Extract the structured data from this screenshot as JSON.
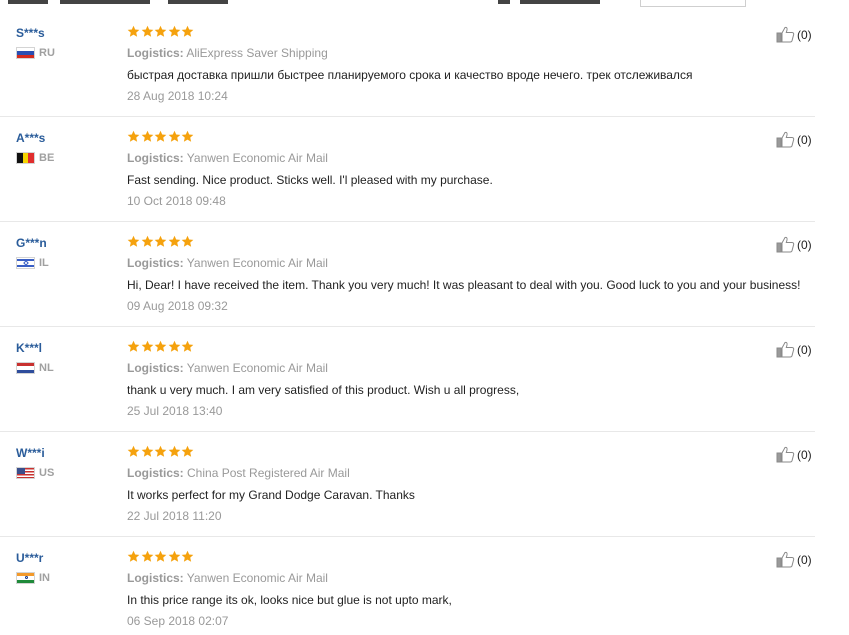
{
  "reviews": [
    {
      "user": "S***s",
      "country": "RU",
      "logistics_label": "Logistics:",
      "logistics": "AliExpress Saver Shipping",
      "comment": "быстрая доставка пришли быстрее планируемого срока и качество вроде нечего. трек отслеживался",
      "date": "28 Aug 2018 10:24",
      "helpful": "(0)",
      "rating": 5
    },
    {
      "user": "A***s",
      "country": "BE",
      "logistics_label": "Logistics:",
      "logistics": "Yanwen Economic Air Mail",
      "comment": "Fast sending. Nice product. Sticks well. I'l pleased with my purchase.",
      "date": "10 Oct 2018 09:48",
      "helpful": "(0)",
      "rating": 5
    },
    {
      "user": "G***n",
      "country": "IL",
      "logistics_label": "Logistics:",
      "logistics": "Yanwen Economic Air Mail",
      "comment": "Hi, Dear! I have received the item. Thank you very much! It was pleasant to deal with you. Good luck to you and your business!",
      "date": "09 Aug 2018 09:32",
      "helpful": "(0)",
      "rating": 5
    },
    {
      "user": "K***l",
      "country": "NL",
      "logistics_label": "Logistics:",
      "logistics": "Yanwen Economic Air Mail",
      "comment": "thank u very much. I am very satisfied of this product. Wish u all progress,",
      "date": "25 Jul 2018 13:40",
      "helpful": "(0)",
      "rating": 5
    },
    {
      "user": "W***i",
      "country": "US",
      "logistics_label": "Logistics:",
      "logistics": "China Post Registered Air Mail",
      "comment": "It works perfect for my Grand Dodge Caravan. Thanks",
      "date": "22 Jul 2018 11:20",
      "helpful": "(0)",
      "rating": 5
    },
    {
      "user": "U***r",
      "country": "IN",
      "logistics_label": "Logistics:",
      "logistics": "Yanwen Economic Air Mail",
      "comment": "In this price range its ok, looks nice but glue is not upto mark,",
      "date": "06 Sep 2018 02:07",
      "helpful": "(0)",
      "rating": 5
    }
  ],
  "colors": {
    "star": "#f5a20e",
    "username": "#2a5c9a",
    "muted": "#999999",
    "divider": "#e8e8e8"
  },
  "icons": {
    "rating": "star-icon",
    "helpful": "thumbs-up-icon"
  }
}
